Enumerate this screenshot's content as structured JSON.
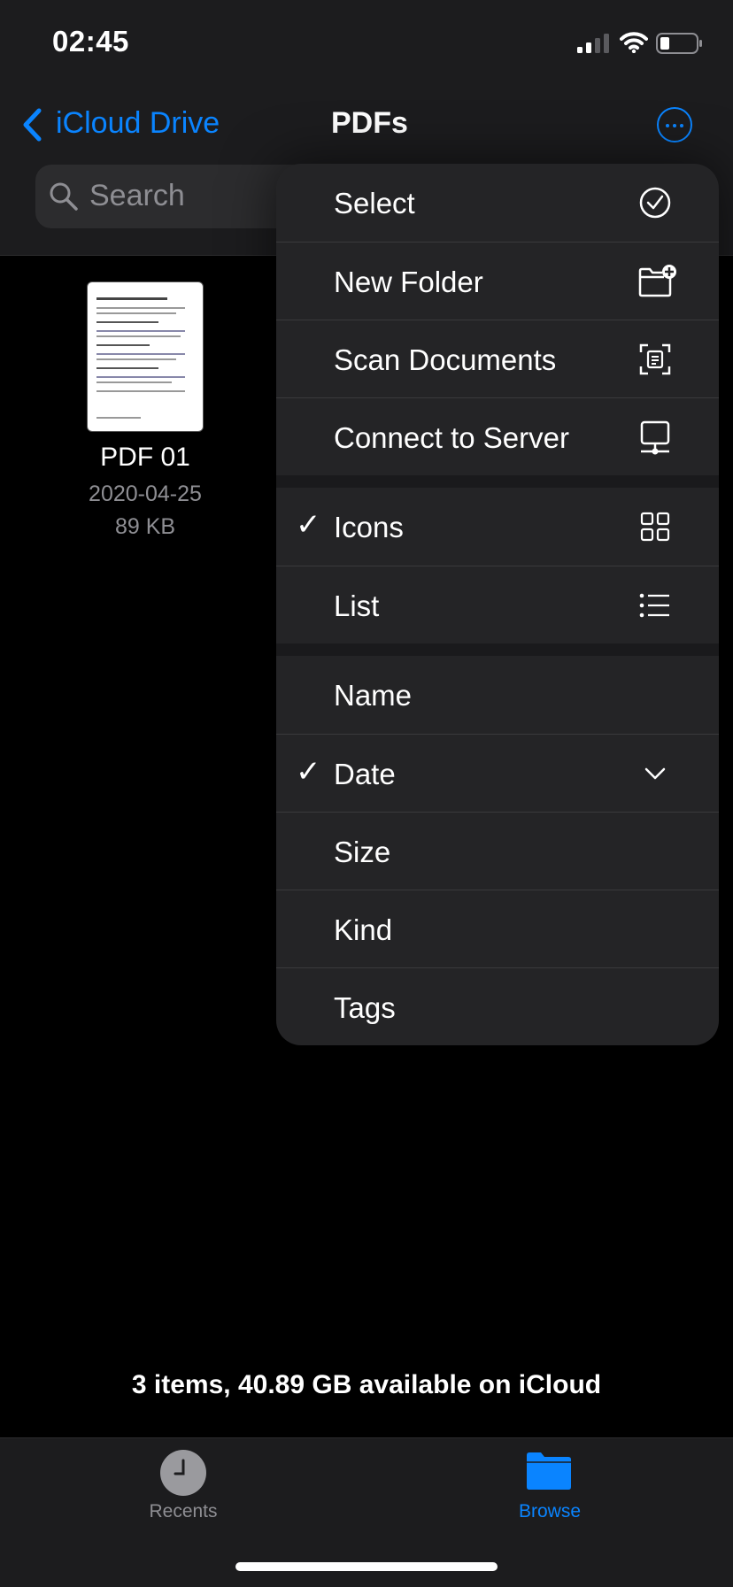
{
  "status_bar": {
    "time": "02:45"
  },
  "nav": {
    "back_label": "iCloud Drive",
    "title": "PDFs"
  },
  "search": {
    "placeholder": "Search"
  },
  "files": [
    {
      "name": "PDF 01",
      "date": "2020-04-25",
      "size": "89 KB"
    }
  ],
  "menu": {
    "actions": [
      {
        "label": "Select",
        "icon": "checkmark-circle-icon"
      },
      {
        "label": "New Folder",
        "icon": "folder-add-icon"
      },
      {
        "label": "Scan Documents",
        "icon": "scan-document-icon"
      },
      {
        "label": "Connect to Server",
        "icon": "server-icon"
      }
    ],
    "view": [
      {
        "label": "Icons",
        "checked": true,
        "icon": "grid-icon"
      },
      {
        "label": "List",
        "checked": false,
        "icon": "list-icon"
      }
    ],
    "sort": [
      {
        "label": "Name",
        "checked": false
      },
      {
        "label": "Date",
        "checked": true,
        "icon": "chevron-down-icon"
      },
      {
        "label": "Size",
        "checked": false
      },
      {
        "label": "Kind",
        "checked": false
      },
      {
        "label": "Tags",
        "checked": false
      }
    ],
    "check_glyph": "✓"
  },
  "footer": {
    "summary": "3 items, 40.89 GB available on iCloud"
  },
  "tabbar": {
    "recents_label": "Recents",
    "browse_label": "Browse",
    "active_tab": "Browse",
    "active_color": "#0a84ff"
  }
}
